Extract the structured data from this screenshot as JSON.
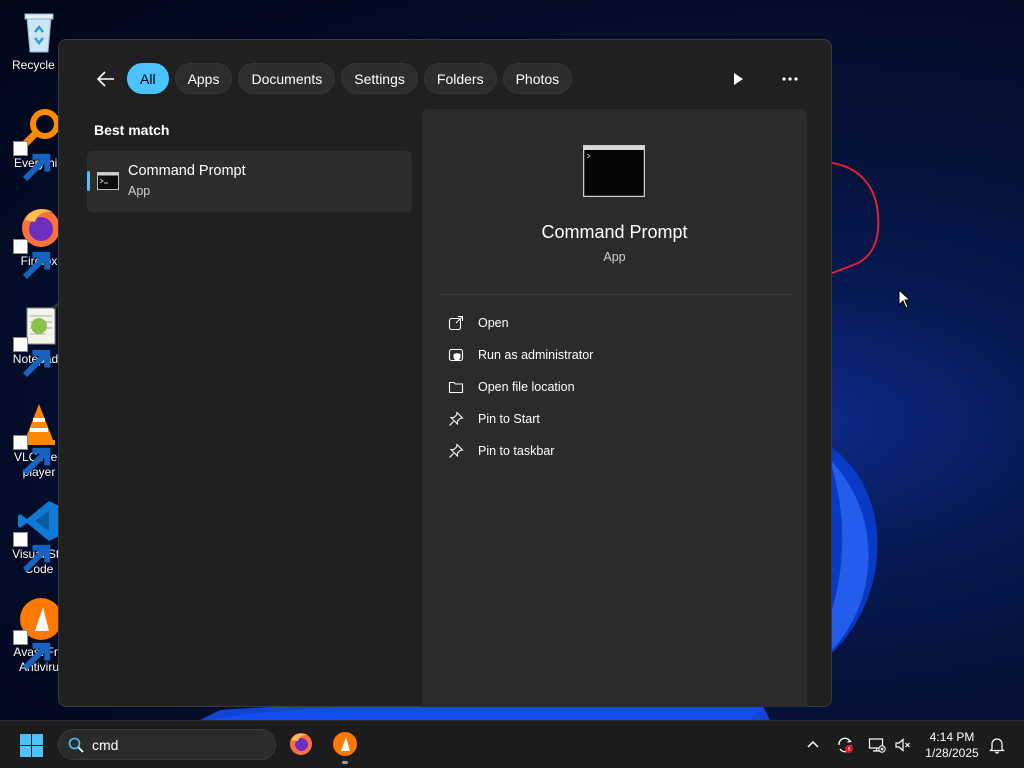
{
  "desktop": {
    "icons": [
      {
        "label": "Recycle B",
        "icon": "recycle-bin-icon"
      },
      {
        "label": "Everythin",
        "icon": "everything-search-icon"
      },
      {
        "label": "Firefox",
        "icon": "firefox-icon"
      },
      {
        "label": "Notepad+",
        "icon": "notepad-plus-plus-icon"
      },
      {
        "label": "VLC med\nplayer",
        "icon": "vlc-icon"
      },
      {
        "label": "Visual Stu\nCode",
        "icon": "vscode-icon"
      },
      {
        "label": "Avast Fre\nAntiviru",
        "icon": "avast-icon"
      }
    ]
  },
  "search_panel": {
    "back_icon": "back-arrow-icon",
    "filters": [
      "All",
      "Apps",
      "Documents",
      "Settings",
      "Folders",
      "Photos"
    ],
    "active_filter": "All",
    "best_match_label": "Best match",
    "result": {
      "title": "Command Prompt",
      "subtitle": "App",
      "icon": "command-prompt-icon"
    },
    "preview": {
      "title": "Command Prompt",
      "subtitle": "App",
      "actions": [
        {
          "label": "Open",
          "icon": "open-external-icon"
        },
        {
          "label": "Run as administrator",
          "icon": "shield-admin-icon"
        },
        {
          "label": "Open file location",
          "icon": "folder-icon"
        },
        {
          "label": "Pin to Start",
          "icon": "pin-icon"
        },
        {
          "label": "Pin to taskbar",
          "icon": "pin-icon"
        }
      ]
    }
  },
  "taskbar": {
    "search_value": "cmd",
    "time": "4:14 PM",
    "date": "1/28/2025"
  },
  "colors": {
    "accent": "#4cc2ff",
    "panel_bg": "#202020",
    "preview_bg": "#2b2b2b",
    "taskbar_bg": "#1c1c1c"
  }
}
